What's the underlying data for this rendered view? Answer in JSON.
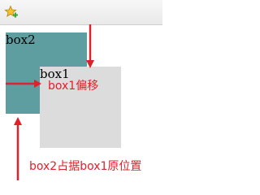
{
  "toolbar": {
    "icon": "star-add-icon"
  },
  "boxes": {
    "box2_label": "box2",
    "box1_label": "box1"
  },
  "annotations": {
    "box1_offset": "box1偏移",
    "box2_position": "box2占据box1原位置"
  },
  "colors": {
    "box2": "#5f9ea0",
    "box1": "#dcdcdc",
    "annotation": "#e0202a"
  }
}
